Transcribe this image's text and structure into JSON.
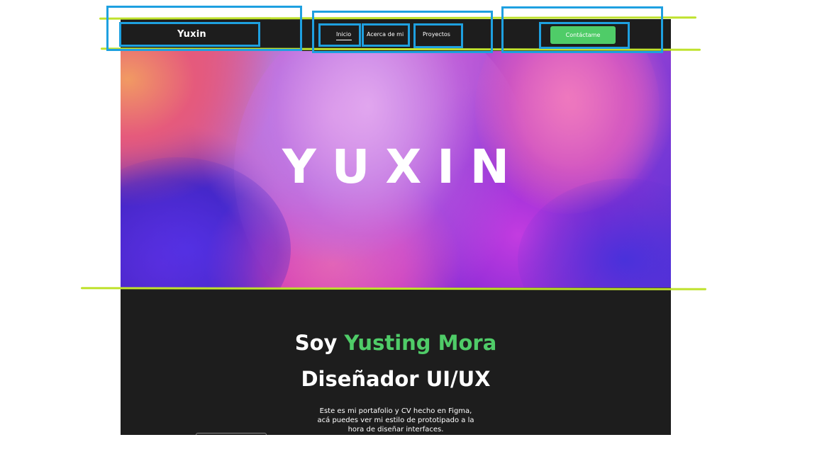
{
  "header": {
    "brand": "Yuxin",
    "nav": [
      {
        "label": "Inicio",
        "active": true
      },
      {
        "label": "Acerca de mi",
        "active": false
      },
      {
        "label": "Proyectos",
        "active": false
      }
    ],
    "contact_label": "Contáctame"
  },
  "hero": {
    "logo_text": "YUXIN"
  },
  "intro": {
    "greeting": "Soy",
    "name": "Yusting Mora",
    "role": "Diseñador UI/UX",
    "description_lines": [
      "Este es mi portafolio y CV hecho en Figma,",
      "acá puedes ver mi estilo de prototipado a la",
      "hora de diseñar interfaces."
    ]
  },
  "colors": {
    "background": "#1d1d1d",
    "accent": "#4fcc68",
    "annotation_box": "#1ea0e0",
    "annotation_line": "#bfe22d"
  }
}
